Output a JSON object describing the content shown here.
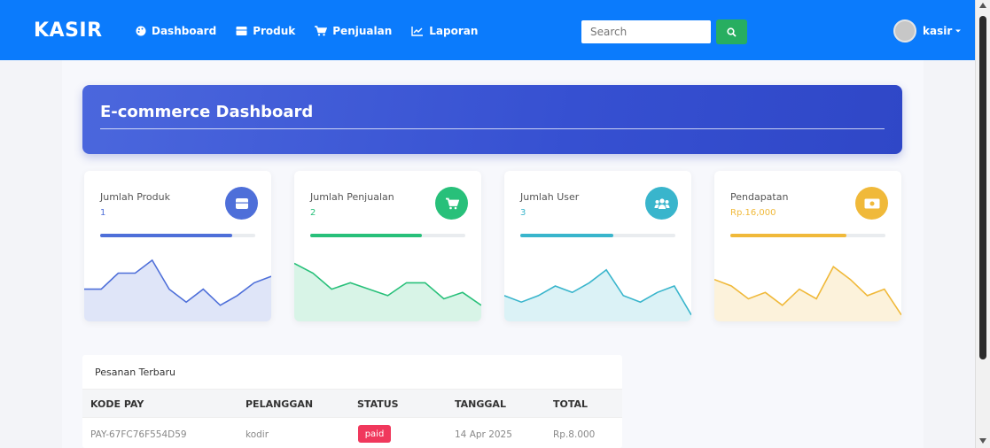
{
  "navbar": {
    "brand": "KASIR",
    "items": [
      {
        "label": "Dashboard",
        "icon": "palette-icon"
      },
      {
        "label": "Produk",
        "icon": "box-icon"
      },
      {
        "label": "Penjualan",
        "icon": "cart-icon"
      },
      {
        "label": "Laporan",
        "icon": "chart-line-icon"
      }
    ],
    "search": {
      "placeholder": "Search"
    },
    "user": {
      "name": "kasir"
    }
  },
  "hero": {
    "title": "E-commerce Dashboard"
  },
  "cards": [
    {
      "label": "Jumlah Produk",
      "value": "1",
      "color": "#4e6fd9",
      "progress": 0.85,
      "sparkline": [
        22,
        22,
        27,
        27,
        31,
        22,
        18,
        22,
        17,
        20,
        24,
        26
      ]
    },
    {
      "label": "Jumlah Penjualan",
      "value": "2",
      "color": "#28c07a",
      "progress": 0.72,
      "sparkline": [
        30,
        27,
        22,
        24,
        22,
        20,
        24,
        24,
        19,
        21,
        17
      ]
    },
    {
      "label": "Jumlah User",
      "value": "3",
      "color": "#39b5cc",
      "progress": 0.6,
      "sparkline": [
        20,
        18,
        20,
        23,
        21,
        24,
        28,
        20,
        18,
        21,
        23,
        14
      ]
    },
    {
      "label": "Pendapatan",
      "value": "Rp.16,000",
      "color": "#f0b93a",
      "progress": 0.75,
      "sparkline": [
        25,
        23,
        19,
        21,
        17,
        22,
        19,
        29,
        25,
        20,
        22,
        14
      ]
    }
  ],
  "orders": {
    "title": "Pesanan Terbaru",
    "columns": [
      "KODE PAY",
      "PELANGGAN",
      "STATUS",
      "TANGGAL",
      "TOTAL"
    ],
    "rows": [
      {
        "kode": "PAY-67FC76F554D59",
        "pelanggan": "kodir",
        "status": "paid",
        "tanggal": "14 Apr 2025",
        "total": "Rp.8.000"
      }
    ]
  },
  "colors": {
    "navbar": "#0b7bfc",
    "search_button": "#27ae60",
    "paid_badge": "#f0385c"
  }
}
